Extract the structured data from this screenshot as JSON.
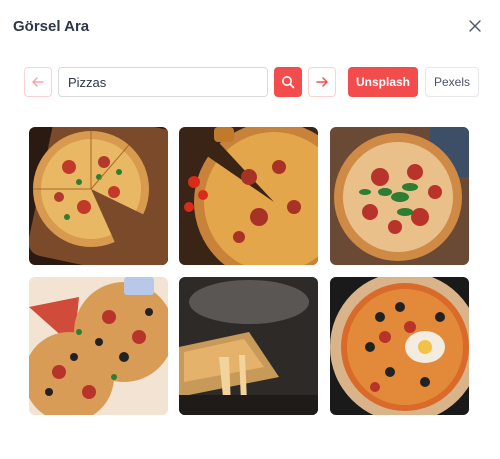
{
  "dialog": {
    "title": "Görsel Ara",
    "close_icon": "close-icon"
  },
  "search": {
    "value": "Pizzas",
    "placeholder": ""
  },
  "toolbar": {
    "prev_icon": "arrow-left-icon",
    "search_icon": "search-icon",
    "next_icon": "arrow-right-icon",
    "unsplash_label": "Unsplash",
    "pexels_label": "Pexels"
  },
  "colors": {
    "accent": "#f34c4c",
    "accent_light": "#fbd2d2"
  },
  "results": [
    {
      "alt": "pizza-on-wooden-board"
    },
    {
      "alt": "pizza-with-tomatoes"
    },
    {
      "alt": "pizza-with-basil"
    },
    {
      "alt": "pizza-slices-with-olives"
    },
    {
      "alt": "cheese-pull-slice"
    },
    {
      "alt": "pizza-with-egg-and-olives"
    }
  ]
}
